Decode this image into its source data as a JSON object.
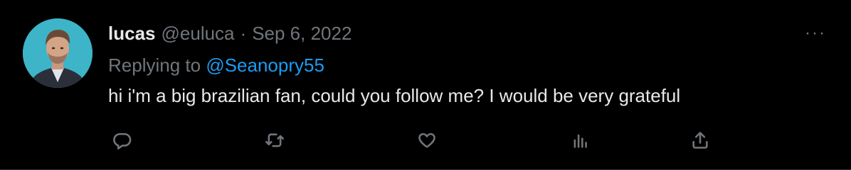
{
  "tweet": {
    "display_name": "lucas",
    "handle": "@euluca",
    "separator": "·",
    "timestamp": "Sep 6, 2022",
    "replying_prefix": "Replying to",
    "replying_to": "@Seanopry55",
    "text": "hi i'm a big brazilian fan, could you follow me? I would be very grateful",
    "more_label": "···"
  },
  "actions": {
    "reply_icon": "reply-icon",
    "retweet_icon": "retweet-icon",
    "like_icon": "heart-icon",
    "analytics_icon": "analytics-icon",
    "share_icon": "share-icon"
  },
  "colors": {
    "background": "#000000",
    "primary_text": "#e7e9ea",
    "secondary_text": "#71767b",
    "accent": "#1d9bf0",
    "avatar_background": "#3db4c8"
  }
}
